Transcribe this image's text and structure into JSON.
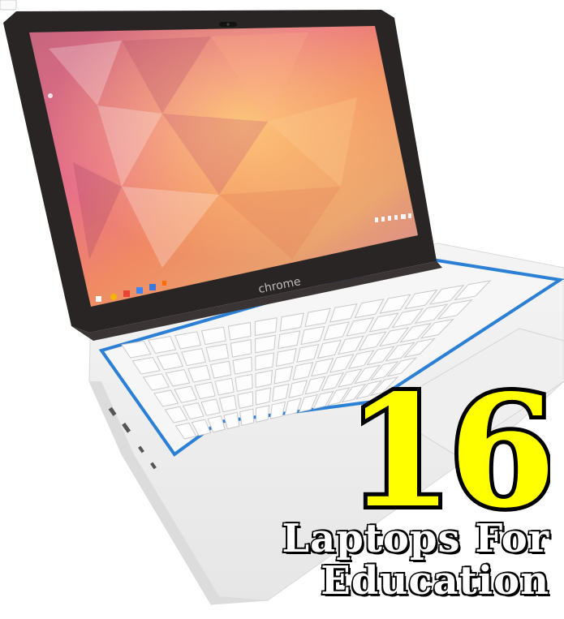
{
  "logo_text": "chrome",
  "number": "16",
  "headline": {
    "line1": "Laptops For",
    "line2": "Education"
  },
  "colors": {
    "number_fill": "#ffff00",
    "number_stroke": "#000000",
    "headline_fill": "#ffffff",
    "keyboard_accent": "#2b7fd4",
    "bezel": "#2a2525"
  },
  "icons": [
    "laptop",
    "shelf-app-icons",
    "status-tray"
  ]
}
